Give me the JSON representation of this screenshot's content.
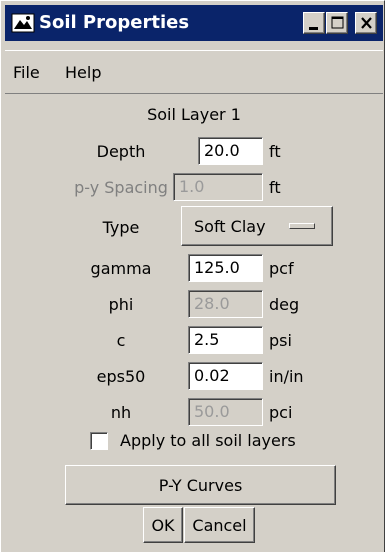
{
  "window": {
    "title": "Soil Properties",
    "icon": "soil-app-icon"
  },
  "window_controls": {
    "minimize": "minimize-icon",
    "maximize": "maximize-icon",
    "close": "close-icon"
  },
  "menu": {
    "file": "File",
    "help": "Help"
  },
  "layer_title": "Soil Layer 1",
  "depth": {
    "label": "Depth",
    "value": "20.0",
    "unit": "ft"
  },
  "spacing": {
    "label": "p-y Spacing",
    "value": "1.0",
    "unit": "ft"
  },
  "type": {
    "label": "Type",
    "value": "Soft Clay"
  },
  "gamma": {
    "label": "gamma",
    "value": "125.0",
    "unit": "pcf"
  },
  "phi": {
    "label": "phi",
    "value": "28.0",
    "unit": "deg"
  },
  "c": {
    "label": "c",
    "value": "2.5",
    "unit": "psi"
  },
  "eps50": {
    "label": "eps50",
    "value": "0.02",
    "unit": "in/in"
  },
  "nh": {
    "label": "nh",
    "value": "50.0",
    "unit": "pci"
  },
  "apply_all": {
    "label": "Apply to all soil layers",
    "checked": false
  },
  "buttons": {
    "py_curves": "P-Y Curves",
    "ok": "OK",
    "cancel": "Cancel"
  }
}
